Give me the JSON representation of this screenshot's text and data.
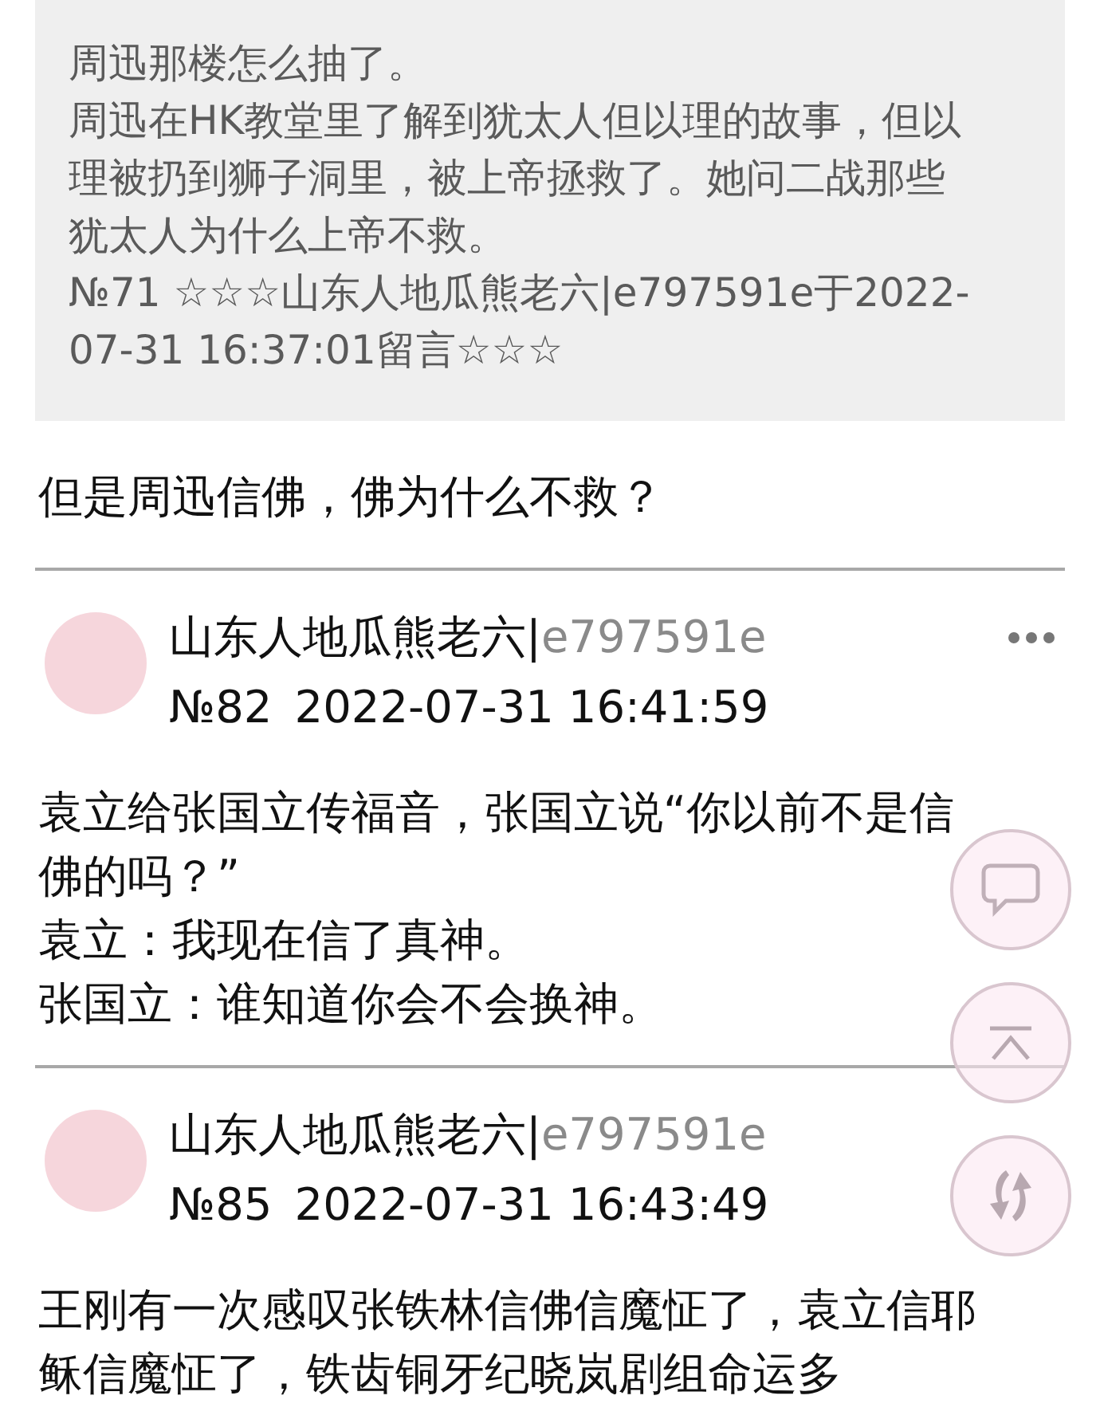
{
  "quote": {
    "paragraphs": [
      "周迅那楼怎么抽了。",
      "周迅在HK教堂里了解到犹太人但以理的故事，但以",
      "理被扔到狮子洞里，被上帝拯救了。她问二战那些",
      "犹太人为什么上帝不救。",
      "№71 ☆☆☆山东人地瓜熊老六|e797591e于2022-",
      "07-31 16:37:01留言☆☆☆"
    ]
  },
  "reply": "但是周迅信佛，佛为什么不救？",
  "posts": [
    {
      "author": "山东人地瓜熊老六|",
      "user_id": "e797591e",
      "number": "№82",
      "time": "2022-07-31 16:41:59",
      "paragraphs": [
        "袁立给张国立传福音，张国立说“你以前不是信",
        "佛的吗？”",
        "袁立：我现在信了真神。",
        "张国立：谁知道你会不会换神。"
      ]
    },
    {
      "author": "山东人地瓜熊老六|",
      "user_id": "e797591e",
      "number": "№85",
      "time": "2022-07-31 16:43:49",
      "paragraphs": [
        "王刚有一次感叹张铁林信佛信魔怔了，袁立信耶",
        "稣信魔怔了，铁齿铜牙纪晓岚剧组命运多"
      ]
    }
  ]
}
